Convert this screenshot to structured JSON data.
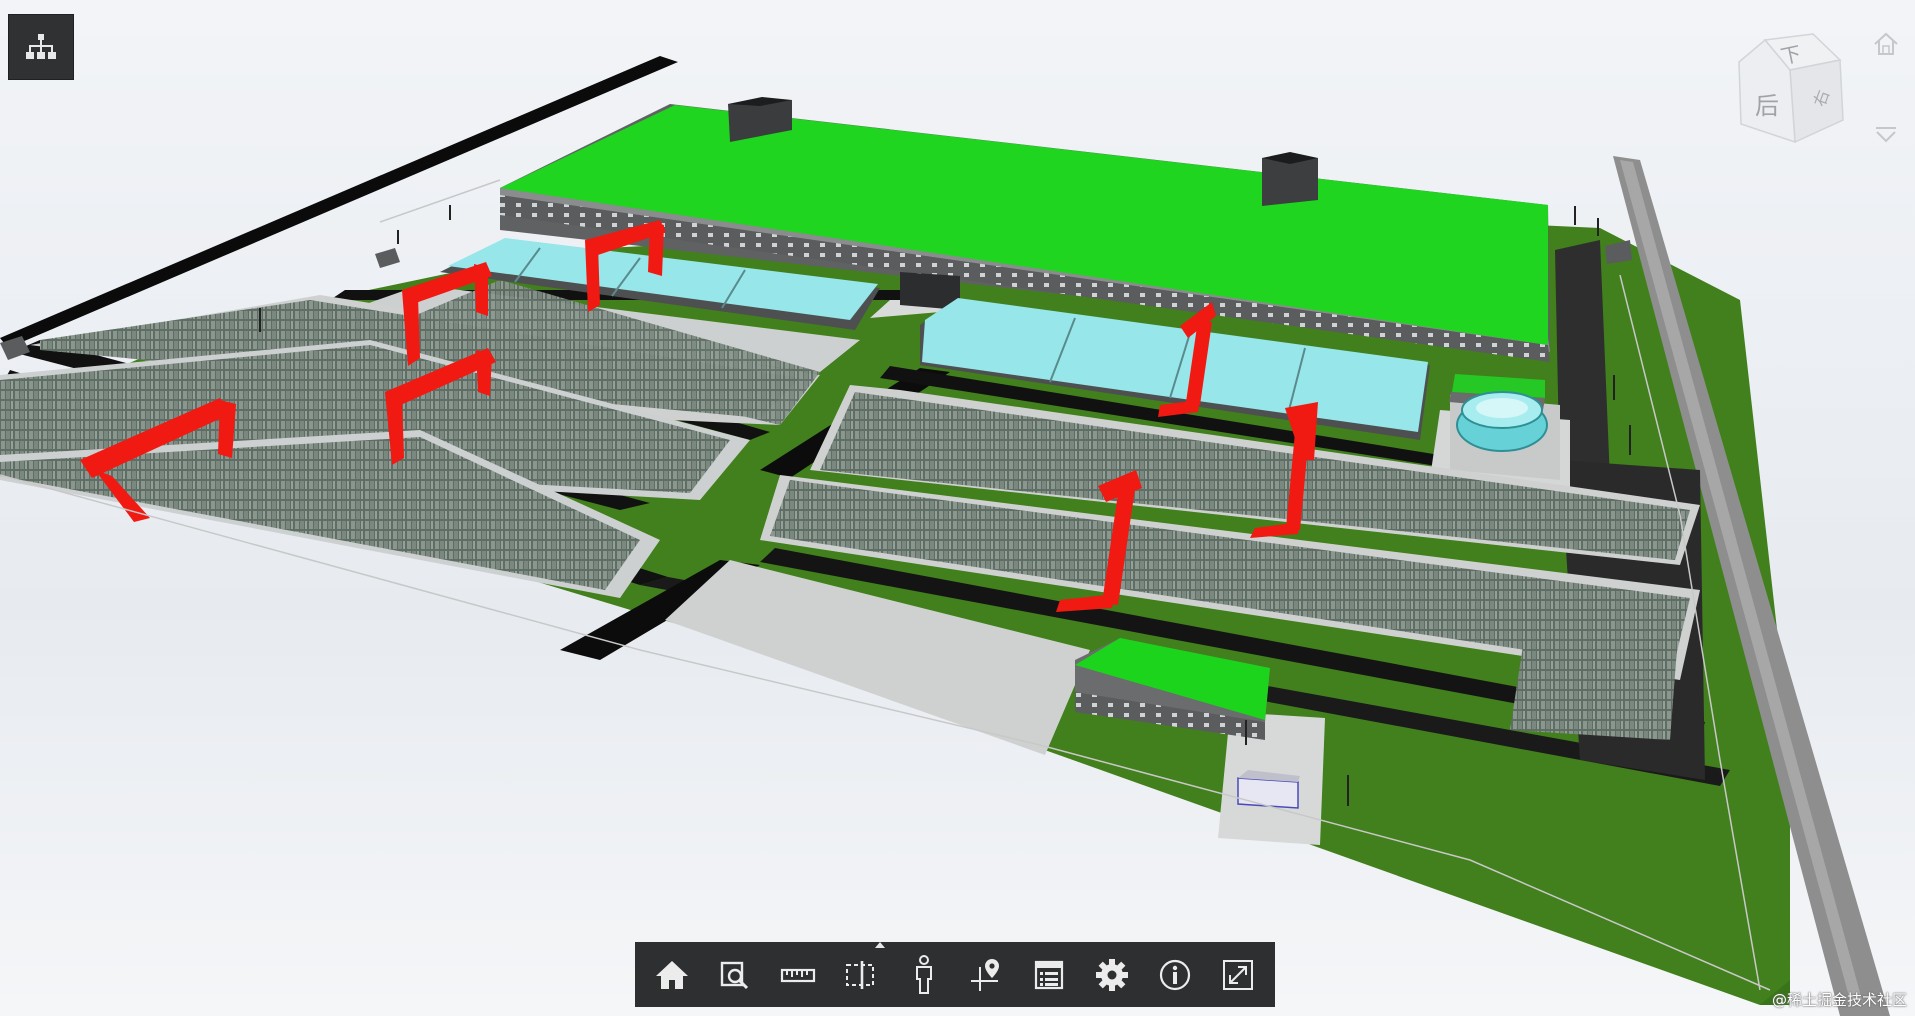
{
  "viewcube": {
    "top_face_label": "下",
    "front_face_label": "后",
    "right_face_label": "右"
  },
  "toolbar": {
    "tools": [
      {
        "id": "home",
        "icon": "home-icon"
      },
      {
        "id": "zoom-window",
        "icon": "zoom-window-icon"
      },
      {
        "id": "measure",
        "icon": "ruler-icon"
      },
      {
        "id": "section",
        "icon": "section-box-icon",
        "has_flyout": true
      },
      {
        "id": "walk",
        "icon": "person-icon"
      },
      {
        "id": "explode",
        "icon": "explode-pin-icon"
      },
      {
        "id": "model-browser",
        "icon": "model-browser-icon"
      },
      {
        "id": "settings",
        "icon": "gear-icon"
      },
      {
        "id": "properties",
        "icon": "info-icon"
      },
      {
        "id": "fullscreen",
        "icon": "fullscreen-icon"
      }
    ]
  },
  "watermark": {
    "text": "@稀土掘金技术社区"
  },
  "colors": {
    "roof": "#19d619",
    "ground": "#3f7d1a",
    "road": "#0c0c0c",
    "glass": "#8fe3e8",
    "crane": "#ee1a12",
    "slab": "#d4d6d6",
    "toolbar": "#2d2f31",
    "stack": "#6d7a72"
  }
}
